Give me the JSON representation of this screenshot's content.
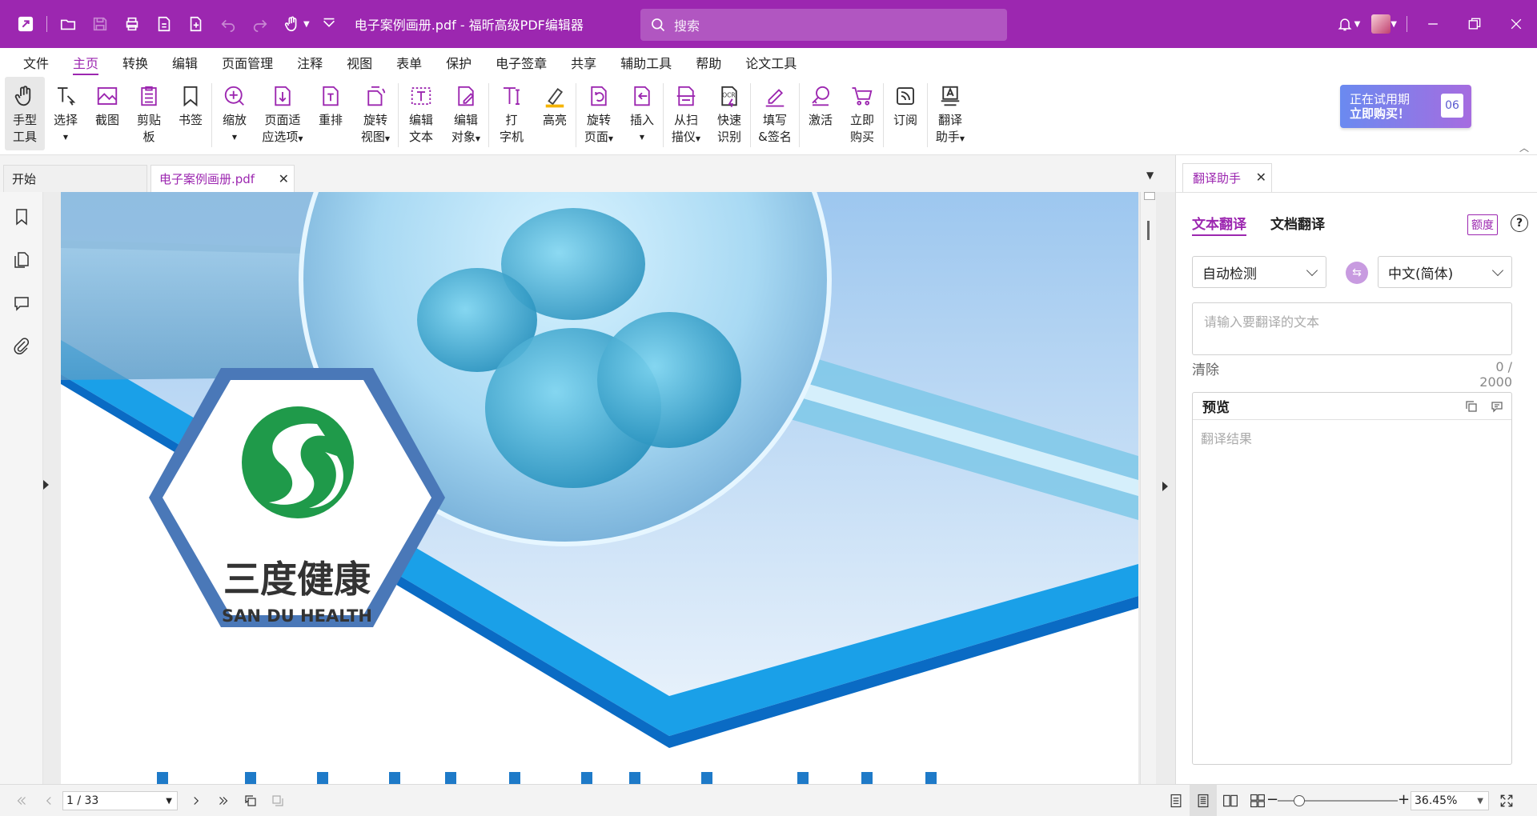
{
  "titlebar": {
    "document_title": "电子案例画册.pdf - 福昕高级PDF编辑器",
    "search_placeholder": "搜索"
  },
  "menu": {
    "items": [
      "文件",
      "主页",
      "转换",
      "编辑",
      "页面管理",
      "注释",
      "视图",
      "表单",
      "保护",
      "电子签章",
      "共享",
      "辅助工具",
      "帮助",
      "论文工具"
    ],
    "active": "主页"
  },
  "ribbon": {
    "tools": [
      {
        "l1": "手型",
        "l2": "工具",
        "icon": "hand-icon"
      },
      {
        "l1": "选择",
        "l2": "",
        "icon": "select-text-icon"
      },
      {
        "l1": "截图",
        "l2": "",
        "icon": "snapshot-icon"
      },
      {
        "l1": "剪贴",
        "l2": "板",
        "icon": "clipboard-icon"
      },
      {
        "l1": "书签",
        "l2": "",
        "icon": "bookmark-icon"
      },
      {
        "l1": "缩放",
        "l2": "",
        "icon": "zoom-icon"
      },
      {
        "l1": "页面适",
        "l2": "应选项",
        "icon": "fit-page-icon"
      },
      {
        "l1": "重排",
        "l2": "",
        "icon": "reflow-icon"
      },
      {
        "l1": "旋转",
        "l2": "视图",
        "icon": "rotate-view-icon"
      },
      {
        "l1": "编辑",
        "l2": "文本",
        "icon": "edit-text-icon"
      },
      {
        "l1": "编辑",
        "l2": "对象",
        "icon": "edit-object-icon"
      },
      {
        "l1": "打",
        "l2": "字机",
        "icon": "typewriter-icon"
      },
      {
        "l1": "高亮",
        "l2": "",
        "icon": "highlight-icon"
      },
      {
        "l1": "旋转",
        "l2": "页面",
        "icon": "rotate-page-icon"
      },
      {
        "l1": "插入",
        "l2": "",
        "icon": "insert-icon"
      },
      {
        "l1": "从扫",
        "l2": "描仪",
        "icon": "scanner-icon"
      },
      {
        "l1": "快速",
        "l2": "识别",
        "icon": "ocr-icon"
      },
      {
        "l1": "填写",
        "l2": "&签名",
        "icon": "fill-sign-icon"
      },
      {
        "l1": "激活",
        "l2": "",
        "icon": "activate-key-icon"
      },
      {
        "l1": "立即",
        "l2": "购买",
        "icon": "cart-icon"
      },
      {
        "l1": "订阅",
        "l2": "",
        "icon": "subscribe-icon"
      },
      {
        "l1": "翻译",
        "l2": "助手",
        "icon": "translate-icon"
      }
    ],
    "trial_line1": "正在试用期",
    "trial_line2": "立即购买！",
    "trial_days": "06"
  },
  "tabs": {
    "start": "开始",
    "doc": "电子案例画册.pdf"
  },
  "page": {
    "logo_cn": "三度健康",
    "logo_en": "SAN DU HEALTH"
  },
  "panel": {
    "tab": "翻译助手",
    "mode_text": "文本翻译",
    "mode_doc": "文档翻译",
    "quota": "额度",
    "help": "?",
    "source_lang": "自动检测",
    "target_lang": "中文(简体)",
    "input_placeholder": "请输入要翻译的文本",
    "clear": "清除",
    "count": "0 / 2000",
    "preview_title": "预览",
    "result_placeholder": "翻译结果"
  },
  "status": {
    "page": "1 / 33",
    "zoom": "36.45%"
  },
  "colors": {
    "brand": "#9c27b0",
    "logo_green": "#1f9a4a",
    "hex_blue": "#4a78b8"
  }
}
